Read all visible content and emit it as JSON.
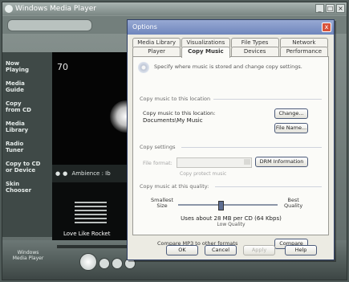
{
  "window": {
    "title": "Windows Media Player"
  },
  "sidebar": {
    "items": [
      {
        "label": "Now\nPlaying"
      },
      {
        "label": "Media\nGuide"
      },
      {
        "label": "Copy\nfrom CD"
      },
      {
        "label": "Media\nLibrary"
      },
      {
        "label": "Radio\nTuner"
      },
      {
        "label": "Copy to CD\nor Device"
      },
      {
        "label": "Skin\nChooser"
      }
    ]
  },
  "visualizer": {
    "time": "70"
  },
  "eq": {
    "label": "Ambience : Ib"
  },
  "playlist": {
    "item": "Love Like Rocket"
  },
  "brand": {
    "label": "Windows\nMedia Player"
  },
  "dialog": {
    "title": "Options",
    "close": "x",
    "tabs_back": [
      "Media Library",
      "Visualizations",
      "File Types",
      "Network"
    ],
    "tabs_front": [
      "Player",
      "Copy Music",
      "Devices",
      "Performance"
    ],
    "active_tab_index": 1,
    "intro": "Specify where music is stored and change copy settings.",
    "location_group": "Copy music to this location",
    "location_caption": "Copy music to this location:",
    "location_path": "Documents\\My Music",
    "change_button": "Change...",
    "filename_button": "File Name...",
    "settings_group": "Copy settings",
    "format_label": "File format:",
    "drm_button": "DRM Information",
    "copy_protect": "Copy protect music",
    "quality_group": "Copy music at this quality:",
    "quality_low": "Smallest\nSize",
    "quality_high": "Best\nQuality",
    "quality_level": 0.42,
    "quality_estimate": "Uses about 28 MB per CD (64 Kbps)",
    "quality_estimate_sub": "Low Quality",
    "compare_label": "Compare MP3 to other formats",
    "compare_button": "Compare",
    "ok": "OK",
    "cancel": "Cancel",
    "apply": "Apply",
    "help": "Help"
  }
}
